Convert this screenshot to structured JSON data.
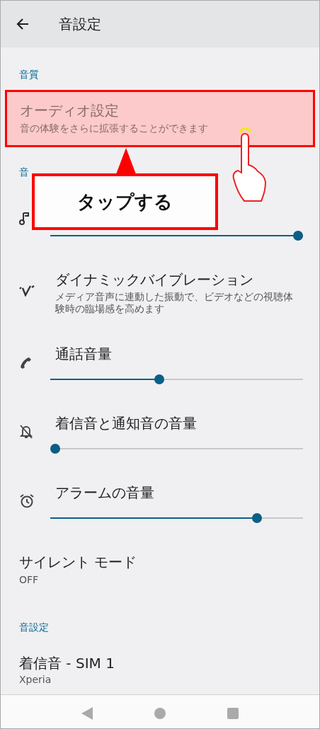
{
  "app_bar": {
    "title": "音設定"
  },
  "sections": [
    {
      "header": "音質",
      "items": [
        {
          "kind": "text",
          "title": "オーディオ設定",
          "subtitle": "音の体験をさらに拡張することができます",
          "highlighted": true
        }
      ]
    },
    {
      "header": "音",
      "items": [
        {
          "kind": "slider",
          "level": 1.0
        },
        {
          "kind": "text",
          "title": "ダイナミックバイブレーション",
          "subtitle": "メディア音声に連動した振動で、ビデオなどの視聴体験時の臨場感を高めます",
          "highlighted": false
        },
        {
          "kind": "slider",
          "title": "通話音量",
          "level": 0.43
        },
        {
          "kind": "slider",
          "title": "着信音と通知音の音量",
          "level": 0.0
        },
        {
          "kind": "slider",
          "title": "アラームの音量",
          "level": 0.83
        },
        {
          "kind": "text",
          "title": "サイレント モード",
          "subtitle": "OFF",
          "highlighted": false
        }
      ]
    },
    {
      "header": "音設定",
      "items": [
        {
          "kind": "text",
          "title": "着信音 - SIM 1",
          "subtitle": "Xperia",
          "highlighted": false
        }
      ]
    }
  ],
  "annotation": {
    "callout": "タップする"
  }
}
